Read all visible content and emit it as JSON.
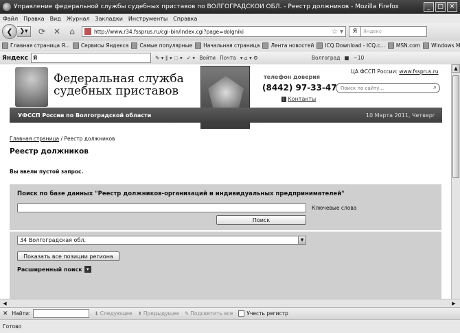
{
  "window": {
    "title": "Управление федеральной службы судебных приставов по ВОЛГОГРАДСКОЙ ОБЛ. - Реестр должников - Mozilla Firefox"
  },
  "menu": [
    "Файл",
    "Правка",
    "Вид",
    "Журнал",
    "Закладки",
    "Инструменты",
    "Справка"
  ],
  "navbar": {
    "url": "http://www.r34.fssprus.ru/cgi-bin/index.cgi?page=dolgniki",
    "search_engine": "Я",
    "search_placeholder": "Яндекс"
  },
  "bookmarks": [
    "Главная страница Я...",
    "Сервисы Яндекса",
    "Самые популярные",
    "Начальная страница",
    "Лента новостей",
    "ICQ Download - ICQ.c...",
    "MSN.com",
    "Windows Media"
  ],
  "yandex_bar": {
    "logo": "Яндекс",
    "query": "Я",
    "login": "Войти",
    "mail": "Почта",
    "weather_city": "Волгоград",
    "temperature": "−10"
  },
  "site": {
    "org_name_line1": "Федеральная служба",
    "org_name_line2": "судебных приставов",
    "hotline_label": "телефон доверия",
    "hotline_number": "(8442) 97-33-47",
    "contacts": "Контакты",
    "central_prefix": "ЦА ФССП России:",
    "central_link": "www.fssprus.ru",
    "search_placeholder": "Поиск по сайту...",
    "region_name": "УФССП России по Волгоградской области",
    "date": "10 Марта 2011, Четверг"
  },
  "breadcrumb": {
    "home": "Главная страница",
    "separator": "/",
    "current": "Реестр должников"
  },
  "page_title": "Реестр должников",
  "empty_query_msg": "Вы ввели пустой запрос.",
  "search_form": {
    "title": "Поиск по базе данных \"Реестр должников-организаций и индивидуальных предпринимателей\"",
    "keywords_value": "",
    "keywords_label": "Ключевые слова",
    "search_button": "Поиск",
    "region_selected": "34 Волгоградская обл.",
    "show_all_button": "Показать все позиции региона",
    "advanced_search": "Расширенный поиск"
  },
  "findbar": {
    "label": "Найти:",
    "value": "",
    "next": "Следующее",
    "previous": "Предыдущее",
    "highlight_all": "Подсветить все",
    "match_case": "Учесть регистр"
  },
  "status": "Готово"
}
